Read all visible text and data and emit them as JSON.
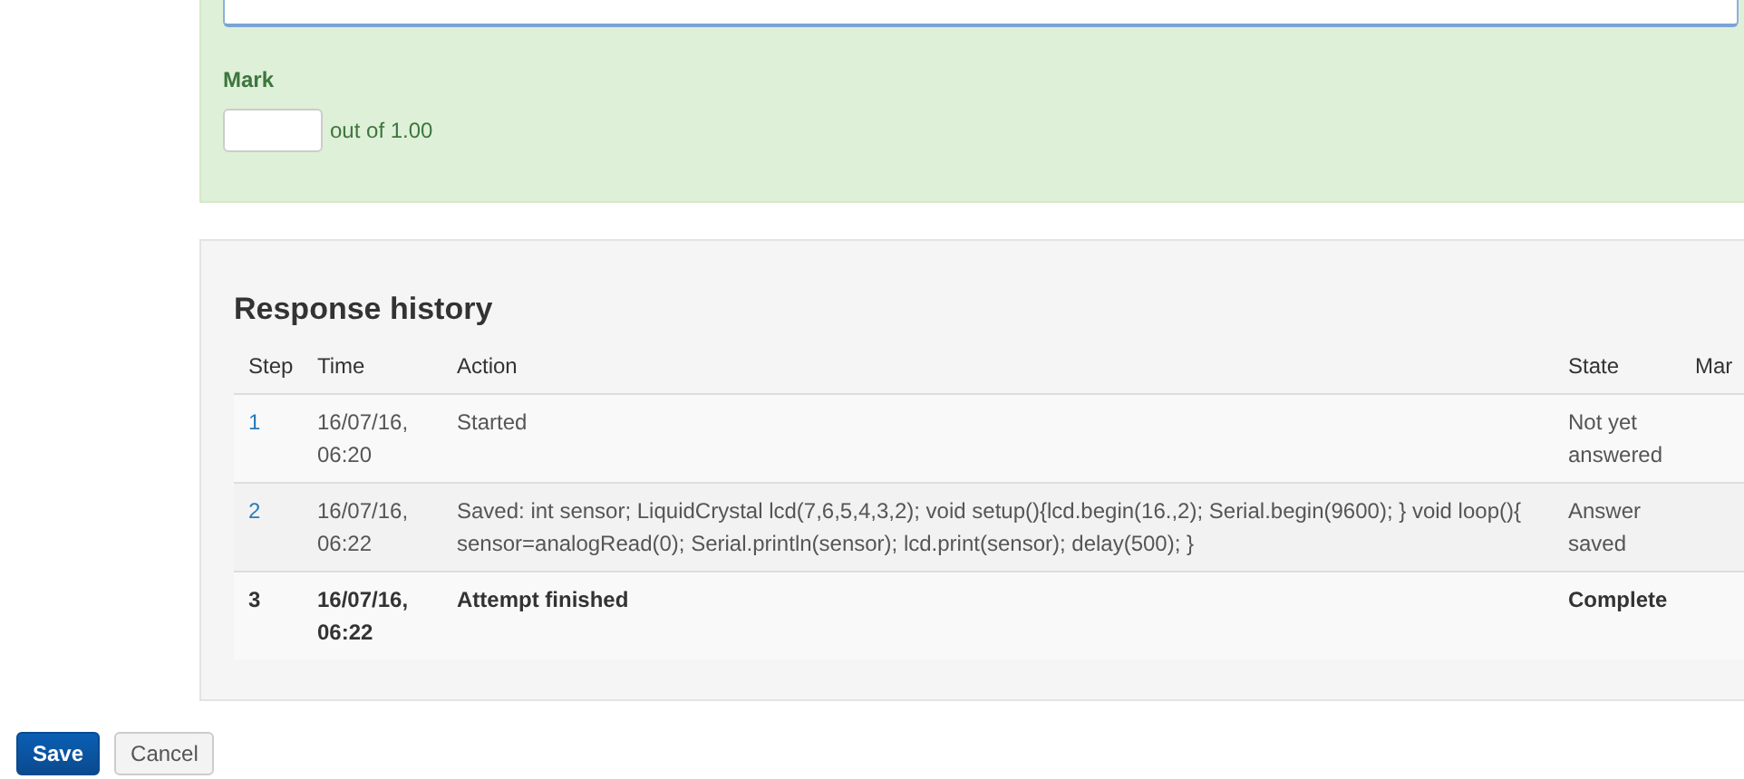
{
  "grading": {
    "label": "Mark",
    "out_of": "out of 1.00"
  },
  "history": {
    "title": "Response history",
    "columns": [
      "Step",
      "Time",
      "Action",
      "State",
      "Mar"
    ],
    "rows": [
      {
        "step": "1",
        "time": "16/07/16, 06:20",
        "action": "Started",
        "state": "Not yet answered",
        "current": false
      },
      {
        "step": "2",
        "time": "16/07/16, 06:22",
        "action": "Saved: int sensor; LiquidCrystal lcd(7,6,5,4,3,2); void setup(){lcd.begin(16.,2);   Serial.begin(9600); } void loop(){   sensor=analogRead(0);   Serial.println(sensor); lcd.print(sensor);   delay(500); }",
        "state": "Answer saved",
        "current": false
      },
      {
        "step": "3",
        "time": "16/07/16, 06:22",
        "action": "Attempt finished",
        "state": "Complete",
        "current": true
      }
    ]
  },
  "buttons": [
    {
      "label": "Save",
      "kind": "primary"
    },
    {
      "label": "Cancel",
      "kind": "default"
    }
  ]
}
